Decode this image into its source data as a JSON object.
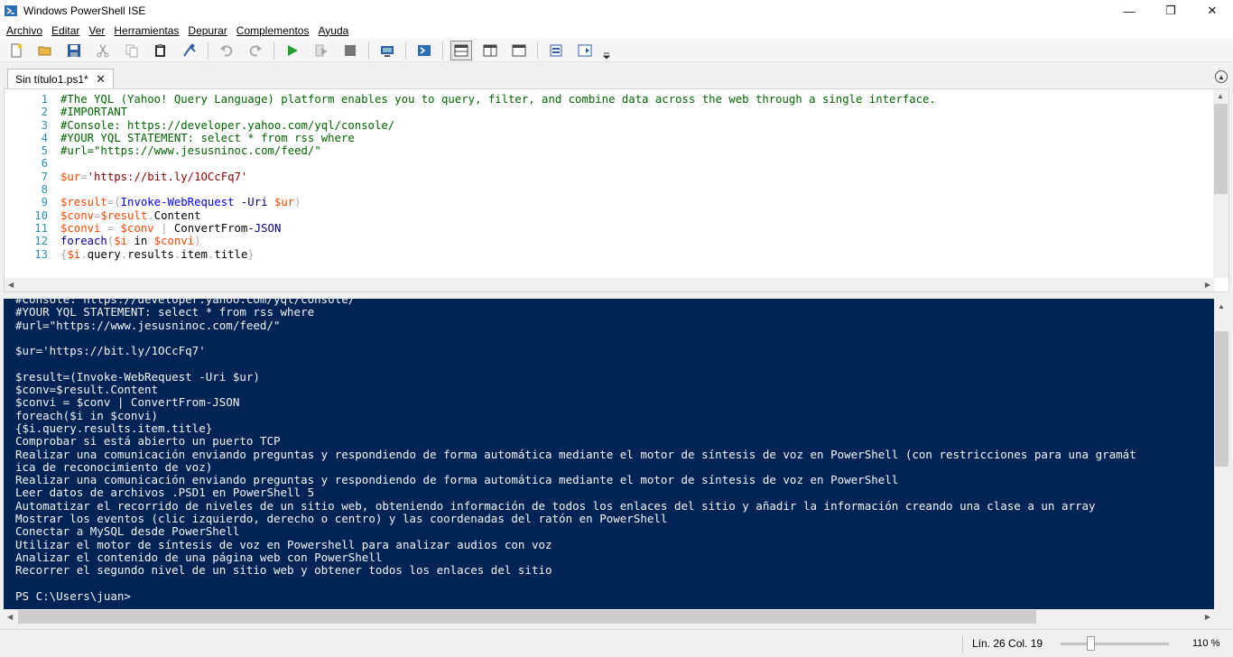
{
  "window": {
    "title": "Windows PowerShell ISE",
    "minimize": "—",
    "maximize": "❐",
    "close": "✕"
  },
  "menu": [
    "Archivo",
    "Editar",
    "Ver",
    "Herramientas",
    "Depurar",
    "Complementos",
    "Ayuda"
  ],
  "toolbar": {
    "icons": [
      "new-icon",
      "open-icon",
      "save-icon",
      "cut-icon",
      "copy-icon",
      "paste-icon",
      "clear-icon",
      "undo-icon",
      "redo-icon",
      "run-icon",
      "run-selection-icon",
      "stop-icon",
      "remote-icon",
      "powershell-console-icon",
      "layout-top-icon",
      "layout-right-icon",
      "layout-max-icon",
      "show-commands-icon",
      "addon-icon"
    ]
  },
  "tab": {
    "label": "Sin título1.ps1*",
    "close": "✕"
  },
  "editor": {
    "line_numbers": [
      "1",
      "2",
      "3",
      "4",
      "5",
      "6",
      "7",
      "8",
      "9",
      "10",
      "11",
      "12",
      "13"
    ],
    "lines": [
      "#The YQL (Yahoo! Query Language) platform enables you to query, filter, and combine data across the web through a single interface.",
      "#IMPORTANT",
      "#Console: https://developer.yahoo.com/yql/console/",
      "#YOUR YQL STATEMENT: select * from rss where",
      "#url=\"https://www.jesusninoc.com/feed/\"",
      "",
      "$ur='https://bit.ly/1OCcFq7'",
      "",
      "$result=(Invoke-WebRequest -Uri $ur)",
      "$conv=$result.Content",
      "$convi = $conv | ConvertFrom-JSON",
      "foreach($i in $convi)",
      "{$i.query.results.item.title}"
    ]
  },
  "console": {
    "lines": [
      "#Console: https://developer.yahoo.com/yql/console/",
      "#YOUR YQL STATEMENT: select * from rss where",
      "#url=\"https://www.jesusninoc.com/feed/\"",
      "",
      "$ur='https://bit.ly/1OCcFq7'",
      "",
      "$result=(Invoke-WebRequest -Uri $ur)",
      "$conv=$result.Content",
      "$convi = $conv | ConvertFrom-JSON",
      "foreach($i in $convi)",
      "{$i.query.results.item.title}",
      "Comprobar si está abierto un puerto TCP",
      "Realizar una comunicación enviando preguntas y respondiendo de forma automática mediante el motor de síntesis de voz en PowerShell (con restricciones para una gramát",
      "ica de reconocimiento de voz)",
      "Realizar una comunicación enviando preguntas y respondiendo de forma automática mediante el motor de síntesis de voz en PowerShell",
      "Leer datos de archivos .PSD1 en PowerShell 5",
      "Automatizar el recorrido de niveles de un sitio web, obteniendo información de todos los enlaces del sitio y añadir la información creando una clase a un array",
      "Mostrar los eventos (clic izquierdo, derecho o centro) y las coordenadas del ratón en PowerShell",
      "Conectar a MySQL desde PowerShell",
      "Utilizar el motor de síntesis de voz en Powershell para analizar audios con voz",
      "Analizar el contenido de una página web con PowerShell",
      "Recorrer el segundo nivel de un sitio web y obtener todos los enlaces del sitio",
      "",
      "PS C:\\Users\\juan>"
    ]
  },
  "status": {
    "position": "Lín. 26  Col. 19",
    "zoom": "110 %",
    "zoom_level_percent": 110
  }
}
